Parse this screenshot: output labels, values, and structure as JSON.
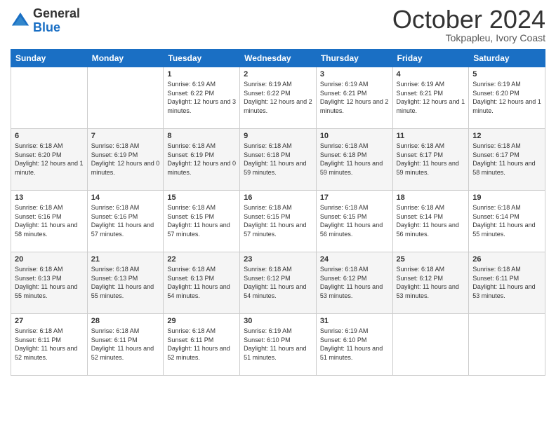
{
  "header": {
    "logo": {
      "general": "General",
      "blue": "Blue"
    },
    "title": "October 2024",
    "subtitle": "Tokpapleu, Ivory Coast"
  },
  "weekdays": [
    "Sunday",
    "Monday",
    "Tuesday",
    "Wednesday",
    "Thursday",
    "Friday",
    "Saturday"
  ],
  "weeks": [
    [
      null,
      null,
      {
        "day": 1,
        "sunrise": "6:19 AM",
        "sunset": "6:22 PM",
        "daylight": "12 hours and 3 minutes."
      },
      {
        "day": 2,
        "sunrise": "6:19 AM",
        "sunset": "6:22 PM",
        "daylight": "12 hours and 2 minutes."
      },
      {
        "day": 3,
        "sunrise": "6:19 AM",
        "sunset": "6:21 PM",
        "daylight": "12 hours and 2 minutes."
      },
      {
        "day": 4,
        "sunrise": "6:19 AM",
        "sunset": "6:21 PM",
        "daylight": "12 hours and 1 minute."
      },
      {
        "day": 5,
        "sunrise": "6:19 AM",
        "sunset": "6:20 PM",
        "daylight": "12 hours and 1 minute."
      }
    ],
    [
      {
        "day": 6,
        "sunrise": "6:18 AM",
        "sunset": "6:20 PM",
        "daylight": "12 hours and 1 minute."
      },
      {
        "day": 7,
        "sunrise": "6:18 AM",
        "sunset": "6:19 PM",
        "daylight": "12 hours and 0 minutes."
      },
      {
        "day": 8,
        "sunrise": "6:18 AM",
        "sunset": "6:19 PM",
        "daylight": "12 hours and 0 minutes."
      },
      {
        "day": 9,
        "sunrise": "6:18 AM",
        "sunset": "6:18 PM",
        "daylight": "11 hours and 59 minutes."
      },
      {
        "day": 10,
        "sunrise": "6:18 AM",
        "sunset": "6:18 PM",
        "daylight": "11 hours and 59 minutes."
      },
      {
        "day": 11,
        "sunrise": "6:18 AM",
        "sunset": "6:17 PM",
        "daylight": "11 hours and 59 minutes."
      },
      {
        "day": 12,
        "sunrise": "6:18 AM",
        "sunset": "6:17 PM",
        "daylight": "11 hours and 58 minutes."
      }
    ],
    [
      {
        "day": 13,
        "sunrise": "6:18 AM",
        "sunset": "6:16 PM",
        "daylight": "11 hours and 58 minutes."
      },
      {
        "day": 14,
        "sunrise": "6:18 AM",
        "sunset": "6:16 PM",
        "daylight": "11 hours and 57 minutes."
      },
      {
        "day": 15,
        "sunrise": "6:18 AM",
        "sunset": "6:15 PM",
        "daylight": "11 hours and 57 minutes."
      },
      {
        "day": 16,
        "sunrise": "6:18 AM",
        "sunset": "6:15 PM",
        "daylight": "11 hours and 57 minutes."
      },
      {
        "day": 17,
        "sunrise": "6:18 AM",
        "sunset": "6:15 PM",
        "daylight": "11 hours and 56 minutes."
      },
      {
        "day": 18,
        "sunrise": "6:18 AM",
        "sunset": "6:14 PM",
        "daylight": "11 hours and 56 minutes."
      },
      {
        "day": 19,
        "sunrise": "6:18 AM",
        "sunset": "6:14 PM",
        "daylight": "11 hours and 55 minutes."
      }
    ],
    [
      {
        "day": 20,
        "sunrise": "6:18 AM",
        "sunset": "6:13 PM",
        "daylight": "11 hours and 55 minutes."
      },
      {
        "day": 21,
        "sunrise": "6:18 AM",
        "sunset": "6:13 PM",
        "daylight": "11 hours and 55 minutes."
      },
      {
        "day": 22,
        "sunrise": "6:18 AM",
        "sunset": "6:13 PM",
        "daylight": "11 hours and 54 minutes."
      },
      {
        "day": 23,
        "sunrise": "6:18 AM",
        "sunset": "6:12 PM",
        "daylight": "11 hours and 54 minutes."
      },
      {
        "day": 24,
        "sunrise": "6:18 AM",
        "sunset": "6:12 PM",
        "daylight": "11 hours and 53 minutes."
      },
      {
        "day": 25,
        "sunrise": "6:18 AM",
        "sunset": "6:12 PM",
        "daylight": "11 hours and 53 minutes."
      },
      {
        "day": 26,
        "sunrise": "6:18 AM",
        "sunset": "6:11 PM",
        "daylight": "11 hours and 53 minutes."
      }
    ],
    [
      {
        "day": 27,
        "sunrise": "6:18 AM",
        "sunset": "6:11 PM",
        "daylight": "11 hours and 52 minutes."
      },
      {
        "day": 28,
        "sunrise": "6:18 AM",
        "sunset": "6:11 PM",
        "daylight": "11 hours and 52 minutes."
      },
      {
        "day": 29,
        "sunrise": "6:18 AM",
        "sunset": "6:11 PM",
        "daylight": "11 hours and 52 minutes."
      },
      {
        "day": 30,
        "sunrise": "6:19 AM",
        "sunset": "6:10 PM",
        "daylight": "11 hours and 51 minutes."
      },
      {
        "day": 31,
        "sunrise": "6:19 AM",
        "sunset": "6:10 PM",
        "daylight": "11 hours and 51 minutes."
      },
      null,
      null
    ]
  ]
}
